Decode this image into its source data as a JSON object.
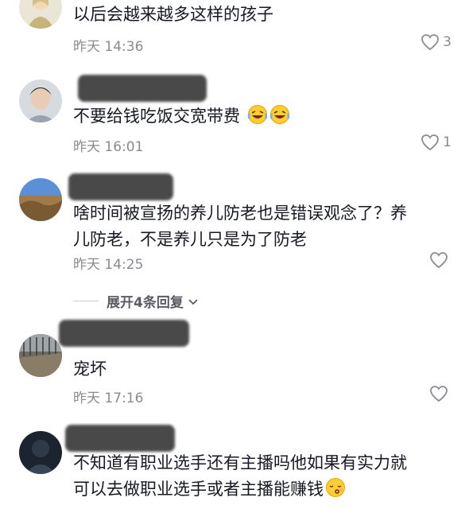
{
  "comments": [
    {
      "text": "以后会越来越多这样的孩子",
      "time": "昨天 14:36",
      "likes": "3"
    },
    {
      "text": "不要给钱吃饭交宽带费",
      "emoji": [
        "laughing-crying-emoji",
        "laughing-crying-emoji"
      ],
      "time": "昨天 16:01",
      "likes": "1"
    },
    {
      "text_line1": "啥时间被宣扬的养儿防老也是错误观念了？养",
      "text_line2": "儿防老，不是养儿只是为了防老",
      "time": "昨天 14:25",
      "likes": ""
    },
    {
      "text": "宠坏",
      "time": "昨天 17:16",
      "likes": ""
    },
    {
      "text_line1": "不知道有职业选手还有主播吗他如果有实力就",
      "text_line2": "可以去做职业选手或者主播能赚钱",
      "emoji": [
        "sleepy-kiss-emoji"
      ]
    }
  ],
  "expand_replies": "展开4条回复",
  "colors": {
    "text": "#161823",
    "meta": "#8a8b91",
    "background": "#ffffff"
  }
}
